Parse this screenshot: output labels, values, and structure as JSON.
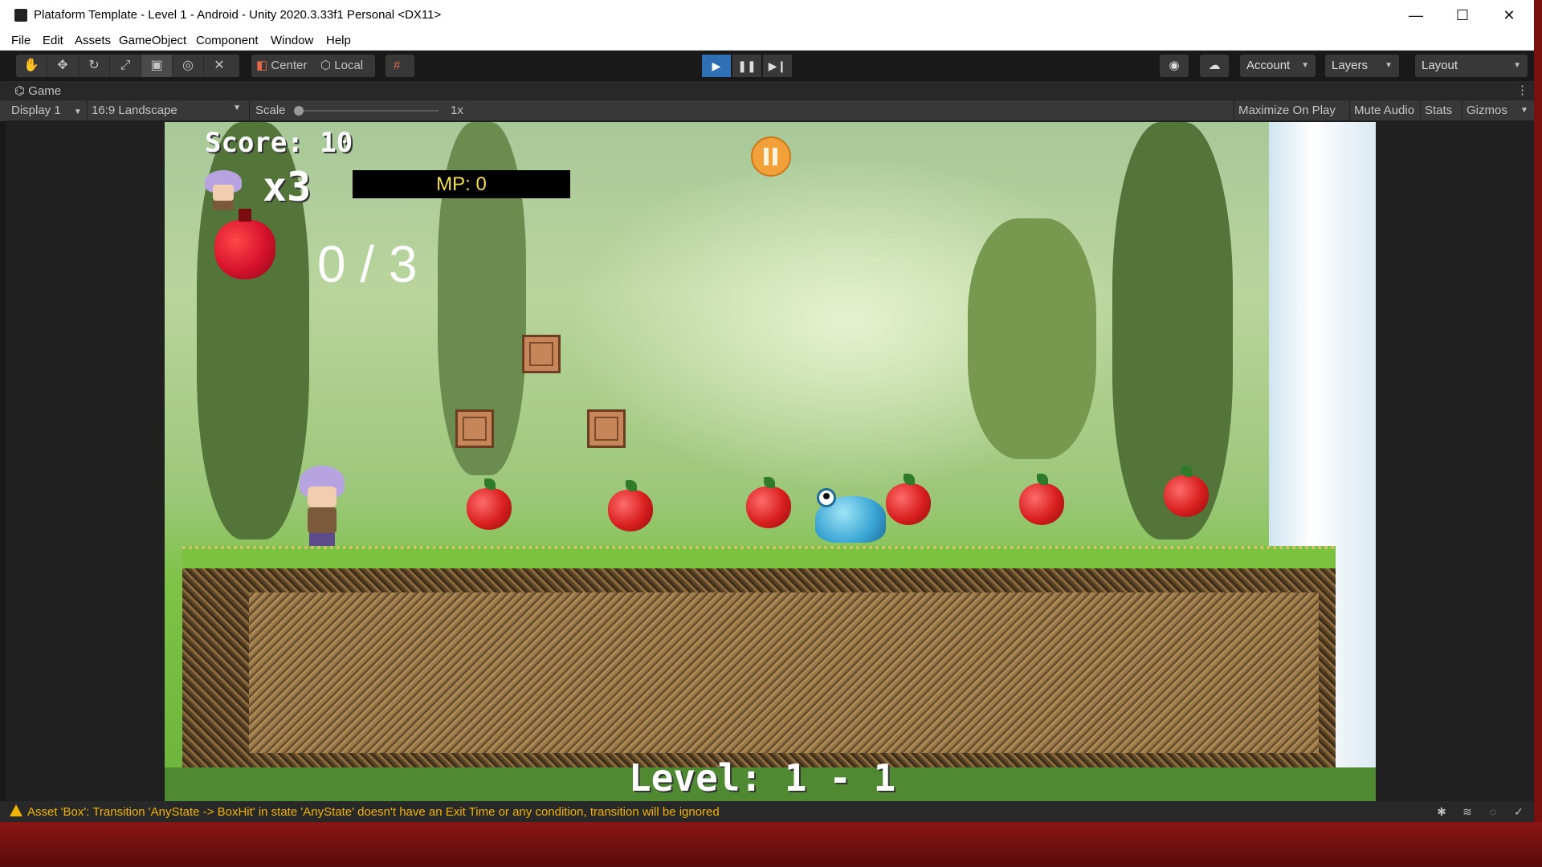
{
  "window": {
    "title": "Plataform Template - Level 1 - Android - Unity 2020.3.33f1 Personal <DX11>",
    "controls": {
      "minimize": "—",
      "maximize": "☐",
      "close": "✕"
    }
  },
  "menu": [
    "File",
    "Edit",
    "Assets",
    "GameObject",
    "Component",
    "Window",
    "Help"
  ],
  "toolbar": {
    "pivot_label": "Center",
    "space_label": "Local",
    "account_label": "Account",
    "layers_label": "Layers",
    "layout_label": "Layout",
    "play_state": "playing",
    "accent_color": "#2f6fb3"
  },
  "game_tab": {
    "label": "Game",
    "display": "Display 1",
    "aspect": "16:9 Landscape",
    "scale_label": "Scale",
    "scale_value": "1x",
    "maximize_label": "Maximize On Play",
    "mute_label": "Mute Audio",
    "stats_label": "Stats",
    "gizmos_label": "Gizmos"
  },
  "hud": {
    "score": "Score: 10",
    "lives": "x3",
    "mp": "MP: 0",
    "apples": "0 / 3",
    "level": "Level: 1 -  1"
  },
  "status": {
    "message": "Asset 'Box': Transition 'AnyState -> BoxHit' in state 'AnyState' doesn't have an Exit Time or any condition, transition will be ignored",
    "message_color": "#f0b400"
  }
}
